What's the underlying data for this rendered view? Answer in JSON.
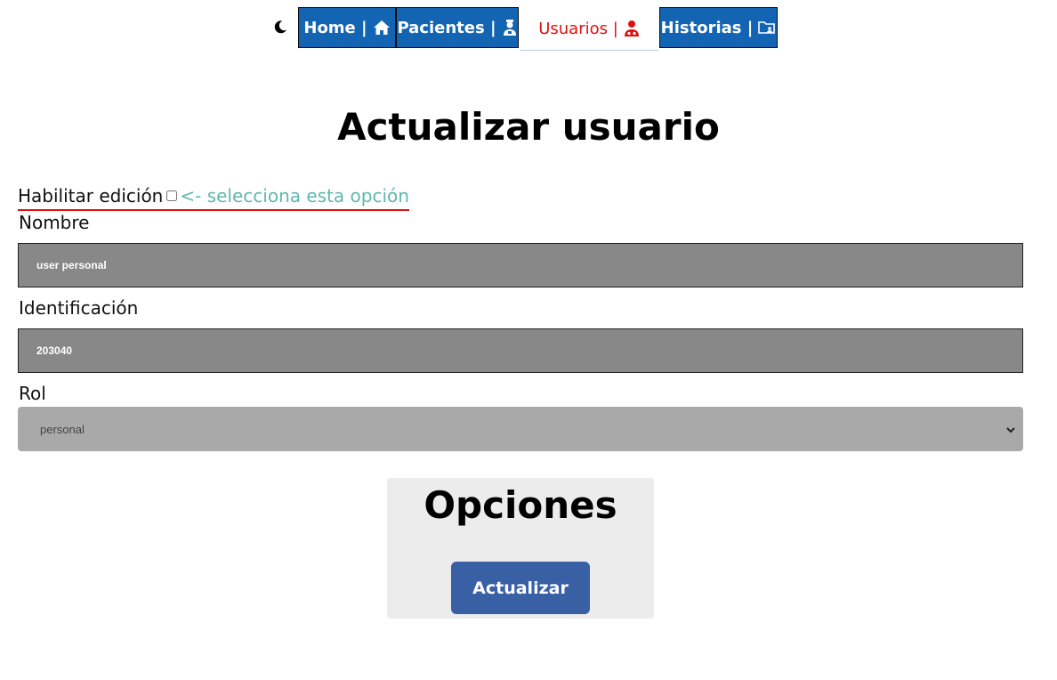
{
  "nav": {
    "theme_icon": "moon-icon",
    "items": [
      {
        "label": "Home |",
        "icon": "home-icon"
      },
      {
        "label": "Pacientes |",
        "icon": "patient-icon"
      },
      {
        "label": "Usuarios |",
        "icon": "user-doctor-icon",
        "active": true
      },
      {
        "label": "Historias |",
        "icon": "folder-user-icon"
      }
    ],
    "active_color": "#e01010",
    "bg_color": "#1464b4"
  },
  "page": {
    "title": "Actualizar usuario"
  },
  "edit_toggle": {
    "label": "Habilitar edición",
    "hint": "<- selecciona esta opción",
    "checked": false
  },
  "form": {
    "nombre_label": "Nombre",
    "nombre_value": "user personal",
    "identificacion_label": "Identificación",
    "identificacion_value": "203040",
    "rol_label": "Rol",
    "rol_value": "personal"
  },
  "options": {
    "title": "Opciones",
    "update_label": "Actualizar"
  }
}
